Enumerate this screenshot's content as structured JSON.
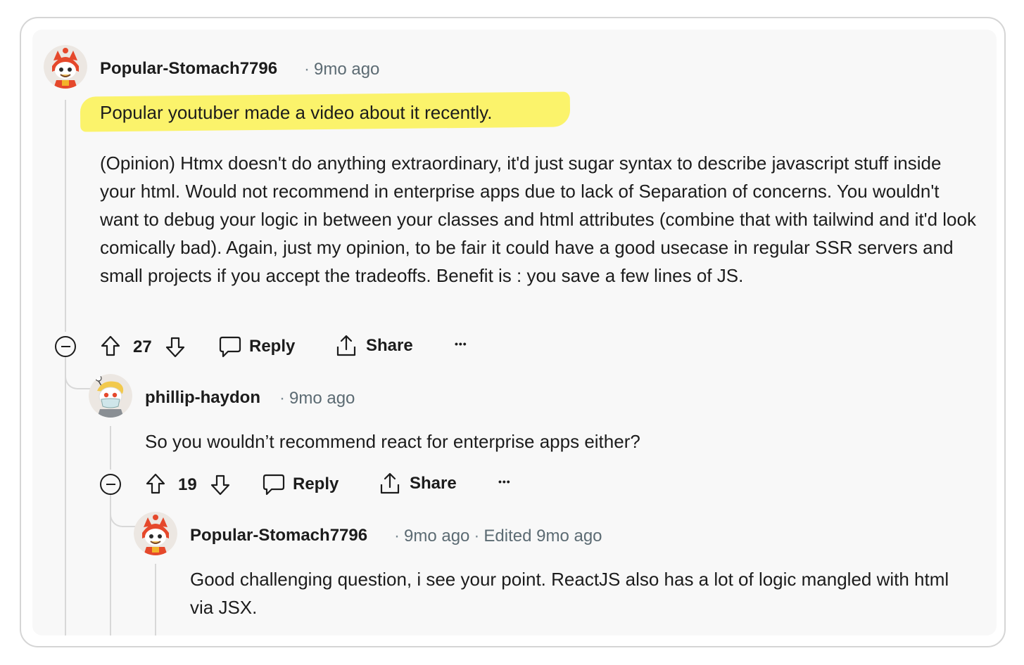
{
  "comments": [
    {
      "username": "Popular-Stomach7796",
      "time": "9mo ago",
      "highlighted_line": "Popular youtuber made a video about it recently.",
      "body": "(Opinion) Htmx doesn't do anything extraordinary, it'd just sugar syntax to describe javascript stuff inside your html. Would not recommend in enterprise apps due to lack of Separation of concerns. You wouldn't want to debug your logic in between your classes and html attributes (combine that with tailwind and it'd look comically bad). Again, just my opinion, to be fair it could have a good usecase in regular SSR servers and small projects if you accept the tradeoffs. Benefit is : you save a few lines of JS.",
      "votes": "27",
      "reply_label": "Reply",
      "share_label": "Share",
      "more_label": "•••"
    },
    {
      "username": "phillip-haydon",
      "time": "9mo ago",
      "body": "So you wouldn’t recommend react for enterprise apps either?",
      "votes": "19",
      "reply_label": "Reply",
      "share_label": "Share",
      "more_label": "•••"
    },
    {
      "username": "Popular-Stomach7796",
      "time": "9mo ago",
      "edited": "Edited 9mo ago",
      "body": "Good challenging question, i see your point. ReactJS also has a lot of logic mangled with html via JSX."
    }
  ],
  "colors": {
    "highlight": "#fbf36b",
    "thread_line": "#d8d8d8",
    "meta_text": "#5c6b73"
  },
  "icons": [
    "minus-circle-icon",
    "upvote-arrow-icon",
    "downvote-arrow-icon",
    "comment-bubble-icon",
    "share-icon",
    "more-dots-icon"
  ]
}
